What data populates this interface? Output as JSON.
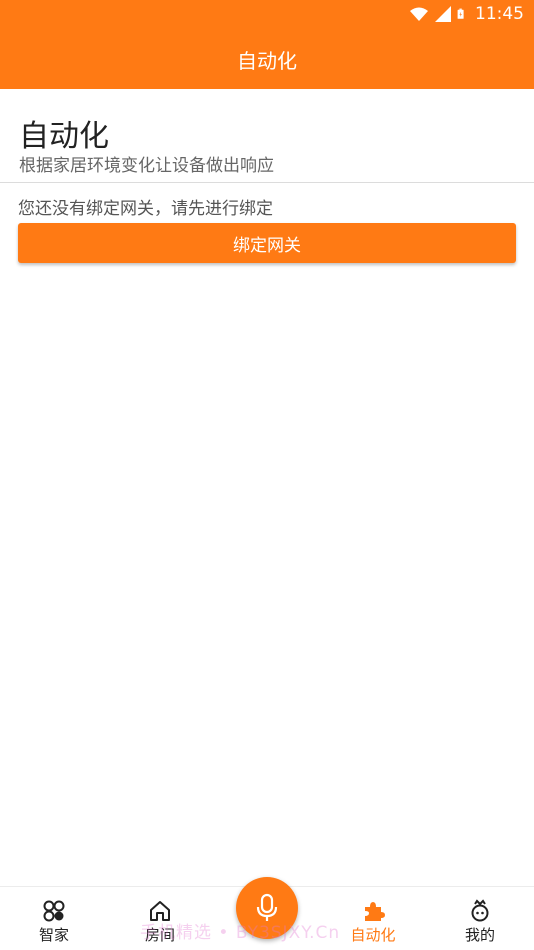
{
  "status_bar": {
    "time": "11:45"
  },
  "app_bar": {
    "title": "自动化"
  },
  "header": {
    "title": "自动化",
    "subtitle": "根据家居环境变化让设备做出响应"
  },
  "content": {
    "notice": "您还没有绑定网关，请先进行绑定",
    "bind_button_label": "绑定网关"
  },
  "bottom_nav": {
    "items": [
      {
        "label": "智家",
        "icon": "four-circles-icon",
        "active": false
      },
      {
        "label": "房间",
        "icon": "house-icon",
        "active": false
      },
      {
        "label": "自动化",
        "icon": "puzzle-icon",
        "active": true
      },
      {
        "label": "我的",
        "icon": "profile-icon",
        "active": false
      }
    ],
    "center_button_icon": "microphone-icon"
  },
  "watermark": "手机精选 • BY3SJXY.Cn",
  "colors": {
    "accent": "#ff7a14",
    "text_primary": "#222222",
    "text_secondary": "#666666"
  }
}
